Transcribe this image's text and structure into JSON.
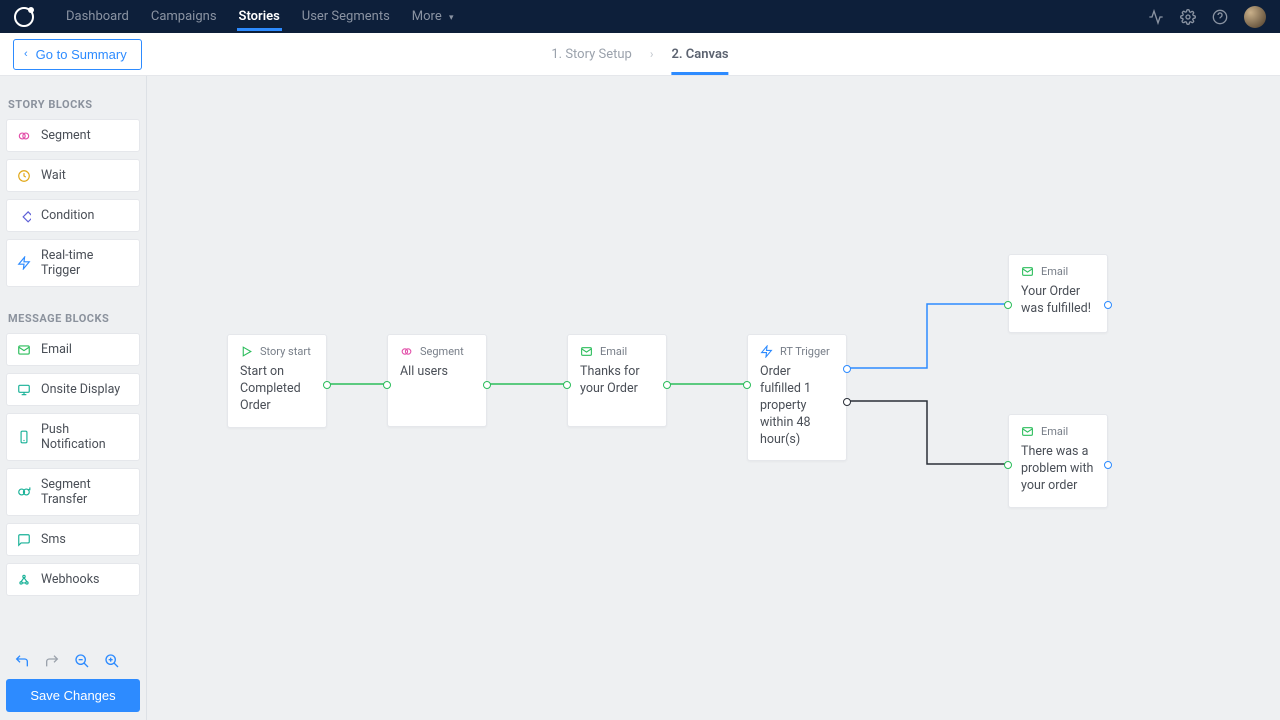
{
  "topnav": {
    "items": [
      "Dashboard",
      "Campaigns",
      "Stories",
      "User Segments",
      "More"
    ],
    "active_index": 2
  },
  "subheader": {
    "back_label": "Go to Summary",
    "step1": "1. Story Setup",
    "step2": "2. Canvas"
  },
  "sidebar": {
    "heading_story": "STORY BLOCKS",
    "heading_msg": "MESSAGE BLOCKS",
    "story_blocks": [
      "Segment",
      "Wait",
      "Condition",
      "Real-time Trigger"
    ],
    "message_blocks": [
      "Email",
      "Onsite Display",
      "Push Notification",
      "Segment Transfer",
      "Sms",
      "Webhooks"
    ],
    "save_label": "Save Changes"
  },
  "nodes": {
    "start": {
      "type": "Story start",
      "body": "Start on Completed Order"
    },
    "segment": {
      "type": "Segment",
      "body": "All users"
    },
    "email1": {
      "type": "Email",
      "body": "Thanks for your Order"
    },
    "trigger": {
      "type": "RT Trigger",
      "body": "Order fulfilled 1 property within 48 hour(s)"
    },
    "email_ok": {
      "type": "Email",
      "body": "Your Order was fulfilled!"
    },
    "email_bad": {
      "type": "Email",
      "body": "There was a problem with your order"
    }
  }
}
